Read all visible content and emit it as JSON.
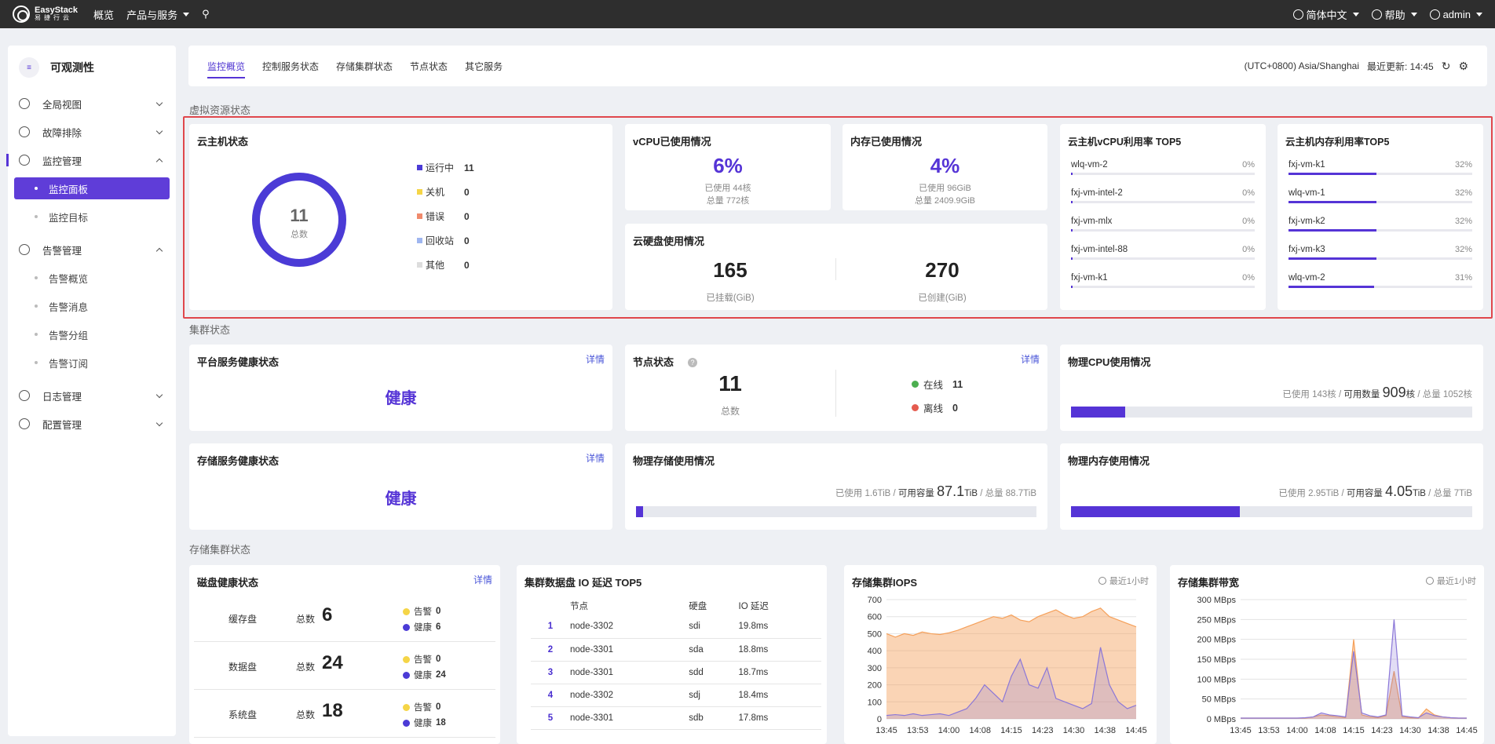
{
  "topbar": {
    "logo_en": "EasyStack",
    "logo_cn": "易捷行云",
    "nav_overview": "概览",
    "nav_products": "产品与服务",
    "lang": "简体中文",
    "help": "帮助",
    "user": "admin"
  },
  "sidebar": {
    "title": "可观测性",
    "items": [
      {
        "label": "全局视图"
      },
      {
        "label": "故障排除"
      },
      {
        "label": "监控管理"
      },
      {
        "label": "监控面板"
      },
      {
        "label": "监控目标"
      },
      {
        "label": "告警管理"
      },
      {
        "label": "告警概览"
      },
      {
        "label": "告警消息"
      },
      {
        "label": "告警分组"
      },
      {
        "label": "告警订阅"
      },
      {
        "label": "日志管理"
      },
      {
        "label": "配置管理"
      }
    ]
  },
  "tabs": [
    {
      "label": "监控概览"
    },
    {
      "label": "控制服务状态"
    },
    {
      "label": "存储集群状态"
    },
    {
      "label": "节点状态"
    },
    {
      "label": "其它服务"
    }
  ],
  "timezone": "(UTC+0800) Asia/Shanghai",
  "last_update": "最近更新: 14:45",
  "sections": {
    "vr": "虚拟资源状态",
    "cluster": "集群状态",
    "storage": "存储集群状态"
  },
  "vm_status": {
    "title": "云主机状态",
    "total": "11",
    "total_label": "总数",
    "legend": [
      {
        "label": "运行中",
        "value": "11",
        "color": "#4b3bd6"
      },
      {
        "label": "关机",
        "value": "0",
        "color": "#f5d547"
      },
      {
        "label": "错误",
        "value": "0",
        "color": "#f08a6c"
      },
      {
        "label": "回收站",
        "value": "0",
        "color": "#9fb6f0"
      },
      {
        "label": "其他",
        "value": "0",
        "color": "#dddddd"
      }
    ]
  },
  "vcpu": {
    "title": "vCPU已使用情况",
    "pct": "6%",
    "used": "已使用 44核",
    "total": "总量 772核"
  },
  "mem": {
    "title": "内存已使用情况",
    "pct": "4%",
    "used": "已使用 96GiB",
    "total": "总量 2409.9GiB"
  },
  "disk": {
    "title": "云硬盘使用情况",
    "mounted": "165",
    "mounted_label": "已挂载(GiB)",
    "created": "270",
    "created_label": "已创建(GiB)"
  },
  "vcpu_top5": {
    "title": "云主机vCPU利用率 TOP5",
    "rows": [
      {
        "name": "wlq-vm-2",
        "pct": "0%",
        "value": 0
      },
      {
        "name": "fxj-vm-intel-2",
        "pct": "0%",
        "value": 0
      },
      {
        "name": "fxj-vm-mlx",
        "pct": "0%",
        "value": 0
      },
      {
        "name": "fxj-vm-intel-88",
        "pct": "0%",
        "value": 0
      },
      {
        "name": "fxj-vm-k1",
        "pct": "0%",
        "value": 0
      }
    ]
  },
  "mem_top5": {
    "title": "云主机内存利用率TOP5",
    "rows": [
      {
        "name": "fxj-vm-k1",
        "pct": "32%",
        "value": 32
      },
      {
        "name": "wlq-vm-1",
        "pct": "32%",
        "value": 32
      },
      {
        "name": "fxj-vm-k2",
        "pct": "32%",
        "value": 32
      },
      {
        "name": "fxj-vm-k3",
        "pct": "32%",
        "value": 32
      },
      {
        "name": "wlq-vm-2",
        "pct": "31%",
        "value": 31
      }
    ]
  },
  "platform_health": {
    "title": "平台服务健康状态",
    "detail": "详情",
    "status": "健康"
  },
  "storage_health": {
    "title": "存储服务健康状态",
    "detail": "详情",
    "status": "健康"
  },
  "node_status": {
    "title": "节点状态",
    "detail": "详情",
    "total": "11",
    "total_label": "总数",
    "online_label": "在线",
    "online": "11",
    "offline_label": "离线",
    "offline": "0"
  },
  "phys_cpu": {
    "title": "物理CPU使用情况",
    "used": "已使用 143核",
    "avail_label": "可用数量",
    "avail": "909",
    "avail_unit": "核",
    "total": "总量 1052核",
    "fraction": 0.136
  },
  "phys_storage": {
    "title": "物理存储使用情况",
    "used": "已使用 1.6TiB",
    "avail_label": "可用容量",
    "avail": "87.1",
    "avail_unit": "TiB",
    "total": "总量 88.7TiB",
    "fraction": 0.018
  },
  "phys_mem": {
    "title": "物理内存使用情况",
    "used": "已使用 2.95TiB",
    "avail_label": "可用容量",
    "avail": "4.05",
    "avail_unit": "TiB",
    "total": "总量 7TiB",
    "fraction": 0.42
  },
  "disk_health": {
    "title": "磁盘健康状态",
    "detail": "详情",
    "total_label": "总数",
    "warn_label": "告警",
    "ok_label": "健康",
    "rows": [
      {
        "name": "缓存盘",
        "total": "6",
        "warn": "0",
        "ok": "6"
      },
      {
        "name": "数据盘",
        "total": "24",
        "warn": "0",
        "ok": "24"
      },
      {
        "name": "系统盘",
        "total": "18",
        "warn": "0",
        "ok": "18"
      }
    ]
  },
  "io_top5": {
    "title": "集群数据盘 IO 延迟 TOP5",
    "headers": [
      "节点",
      "硬盘",
      "IO 延迟"
    ],
    "rows": [
      {
        "rank": "1",
        "node": "node-3302",
        "disk": "sdi",
        "lat": "19.8ms"
      },
      {
        "rank": "2",
        "node": "node-3301",
        "disk": "sda",
        "lat": "18.8ms"
      },
      {
        "rank": "3",
        "node": "node-3301",
        "disk": "sdd",
        "lat": "18.7ms"
      },
      {
        "rank": "4",
        "node": "node-3302",
        "disk": "sdj",
        "lat": "18.4ms"
      },
      {
        "rank": "5",
        "node": "node-3301",
        "disk": "sdb",
        "lat": "17.8ms"
      }
    ]
  },
  "chart_data": [
    {
      "type": "area",
      "title": "存储集群IOPS",
      "range_label": "最近1小时",
      "x": [
        "13:45",
        "13:53",
        "14:00",
        "14:08",
        "14:15",
        "14:23",
        "14:30",
        "14:38",
        "14:45"
      ],
      "ylim": [
        0,
        700
      ],
      "yticks": [
        "0",
        "100",
        "200",
        "300",
        "400",
        "500",
        "600",
        "700"
      ],
      "series": [
        {
          "color": "#f5a05a",
          "values": [
            500,
            480,
            500,
            490,
            510,
            500,
            495,
            505,
            520,
            540,
            560,
            580,
            600,
            590,
            610,
            580,
            570,
            600,
            620,
            640,
            610,
            590,
            600,
            630,
            650,
            600,
            580,
            560,
            540
          ]
        },
        {
          "color": "#8b77d8",
          "values": [
            20,
            25,
            20,
            30,
            20,
            25,
            30,
            20,
            40,
            60,
            120,
            200,
            150,
            100,
            250,
            350,
            200,
            180,
            300,
            120,
            100,
            80,
            60,
            90,
            420,
            200,
            100,
            60,
            80
          ]
        }
      ]
    },
    {
      "type": "area",
      "title": "存储集群带宽",
      "range_label": "最近1小时",
      "x": [
        "13:45",
        "13:53",
        "14:00",
        "14:08",
        "14:15",
        "14:23",
        "14:30",
        "14:38",
        "14:45"
      ],
      "ylim": [
        0,
        300
      ],
      "yticks": [
        "0 MBps",
        "50 MBps",
        "100 MBps",
        "150 MBps",
        "200 MBps",
        "250 MBps",
        "300 MBps"
      ],
      "series": [
        {
          "color": "#f5a05a",
          "values": [
            2,
            2,
            2,
            2,
            2,
            2,
            2,
            2,
            2,
            5,
            10,
            8,
            5,
            3,
            200,
            10,
            5,
            3,
            8,
            120,
            5,
            3,
            2,
            25,
            10,
            5,
            3,
            2,
            2
          ]
        },
        {
          "color": "#8b77d8",
          "values": [
            2,
            2,
            2,
            2,
            2,
            2,
            2,
            2,
            3,
            5,
            15,
            10,
            8,
            5,
            170,
            15,
            8,
            5,
            10,
            250,
            8,
            5,
            3,
            15,
            8,
            5,
            3,
            2,
            2
          ]
        }
      ]
    }
  ]
}
